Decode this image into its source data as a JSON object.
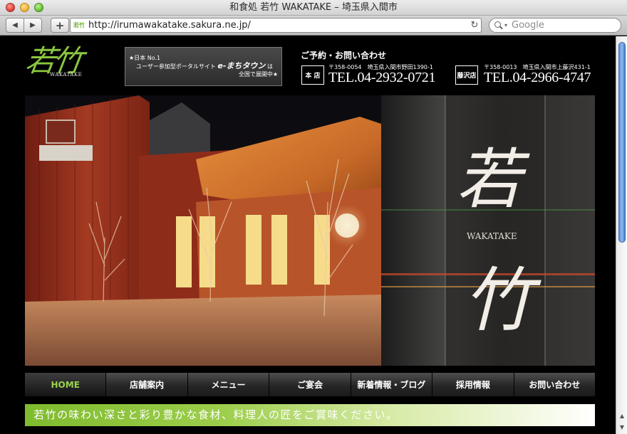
{
  "window": {
    "title": "和食処 若竹 WAKATAKE – 埼玉県入間市"
  },
  "toolbar": {
    "url": "http://irumawakatake.sakura.ne.jp/",
    "search_placeholder": "Google",
    "back_glyph": "◀",
    "forward_glyph": "▶",
    "add_glyph": "+",
    "reload_glyph": "↻",
    "favicon_glyph": "若竹"
  },
  "header": {
    "logo_kanji": "若竹",
    "logo_sub": "WAKATAKE",
    "emachi": {
      "line1": "★日本 No.1",
      "line2_prefix": "ユーザー参加型ポータルサイト ",
      "brand": "e-まちタウン",
      "line2_suffix": " は",
      "line3": "全国で展開中★"
    },
    "contact_title": "ご予約・お問い合わせ",
    "stores": [
      {
        "label": "本 店",
        "address": "〒358-0054　埼玉県入間市野田1390-1",
        "tel": "TEL.04-2932-0721"
      },
      {
        "label": "藤沢店",
        "address": "〒358-0013　埼玉県入間市上藤沢431-1",
        "tel": "TEL.04-2966-4747"
      }
    ]
  },
  "hero": {
    "sign_top": "若",
    "sign_mid": "WAKATAKE",
    "sign_bottom": "竹"
  },
  "nav": {
    "items": [
      {
        "label": "HOME"
      },
      {
        "label": "店舗案内"
      },
      {
        "label": "メニュー"
      },
      {
        "label": "ご宴会"
      },
      {
        "label": "新着情報・ブログ"
      },
      {
        "label": "採用情報"
      },
      {
        "label": "お問い合わせ"
      }
    ],
    "active_index": 0
  },
  "tagline": "若竹の味わい深さと彩り豊かな食材、料理人の匠をご賞味ください。",
  "colors": {
    "accent_green": "#8cc63f",
    "nav_active_text": "#9ad24a"
  }
}
